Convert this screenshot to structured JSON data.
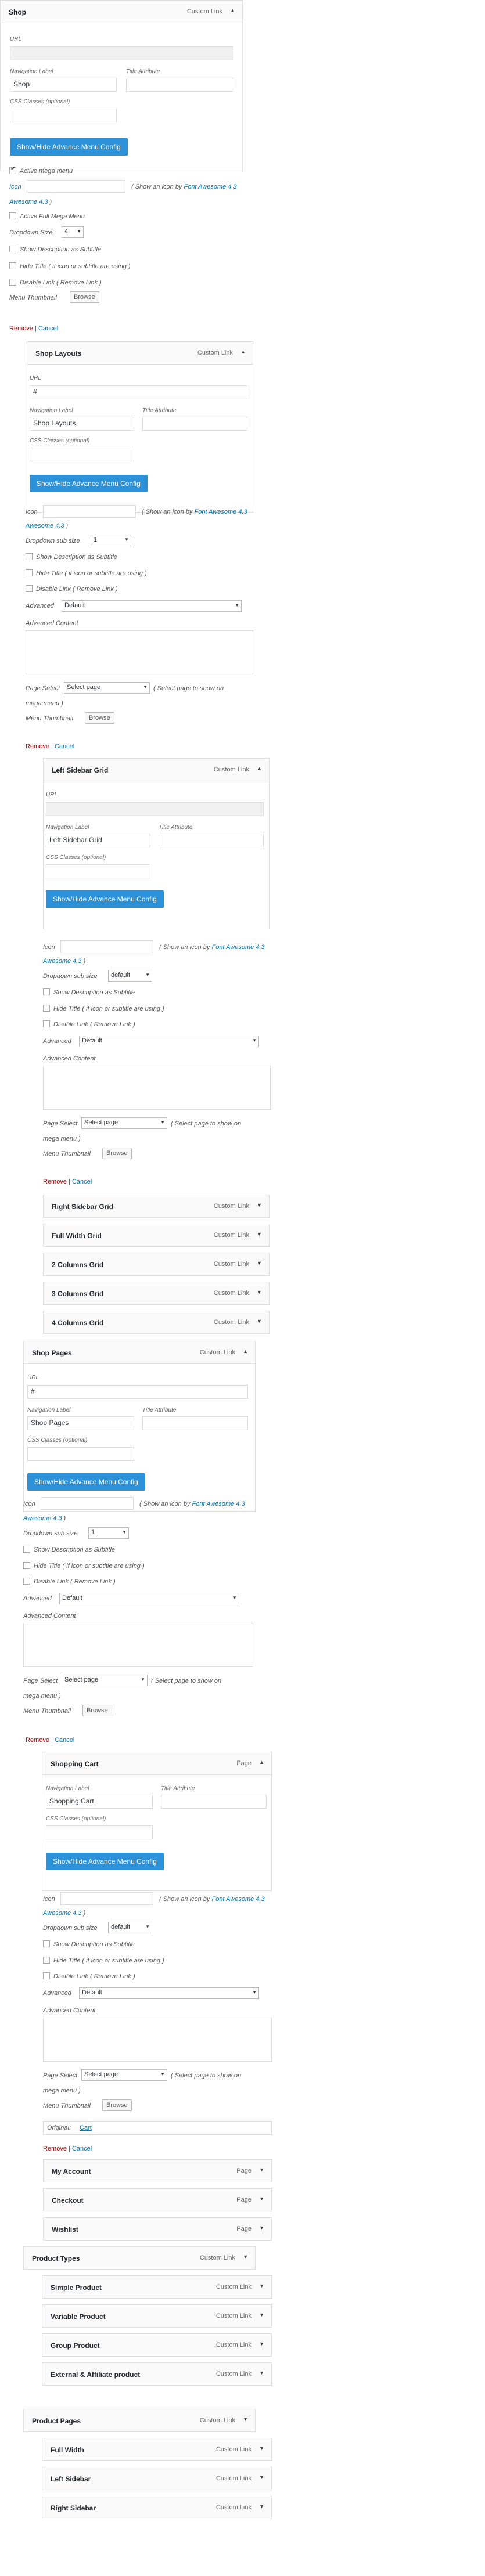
{
  "labels": {
    "url": "URL",
    "nav_label": "Navigation Label",
    "title_attr": "Title Attribute",
    "css_classes": "CSS Classes (optional)",
    "adv_config_btn": "Show/Hide Advance Menu Config",
    "active_mega": "Active mega menu",
    "icon": "Icon",
    "show_icon_pre": "( Show an icon by ",
    "font_awesome": "Font Awesome 4.3 ",
    "show_icon_post": ")",
    "active_full": "Active Full Mega Menu",
    "dropdown_size": "Dropdown Size",
    "dropdown_sub_size": "Dropdown sub size",
    "show_desc": "Show Description as Subtitle",
    "hide_title": "Hide Title ( if icon or subtitle are using )",
    "disable_link": "Disable Link ( Remove Link )",
    "advanced": "Advanced",
    "advanced_content": "Advanced Content",
    "page_select": "Page Select",
    "page_select_hint": "( Select page to show on mega menu )",
    "menu_thumbnail": "Menu Thumbnail",
    "browse": "Browse",
    "remove": "Remove",
    "sep": "|",
    "cancel": "Cancel",
    "original": "Original:",
    "custom_link": "Custom Link",
    "page": "Page"
  },
  "values": {
    "dropdown_size": "4",
    "dropdown_sub_size_1": "1",
    "dropdown_sub_size_default": "default",
    "advanced_default": "Default",
    "select_page": "Select page",
    "url_hash": "#"
  },
  "items": {
    "shop": {
      "title": "Shop",
      "label": "Shop"
    },
    "shop_layouts": {
      "title": "Shop Layouts",
      "label": "Shop Layouts"
    },
    "left_sidebar_grid": {
      "title": "Left Sidebar Grid",
      "label": "Left Sidebar Grid"
    },
    "right_sidebar_grid": {
      "title": "Right Sidebar Grid"
    },
    "full_width_grid": {
      "title": "Full Width Grid"
    },
    "two_columns_grid": {
      "title": "2 Columns Grid"
    },
    "three_columns_grid": {
      "title": "3 Columns Grid"
    },
    "four_columns_grid": {
      "title": "4 Columns Grid"
    },
    "shop_pages": {
      "title": "Shop Pages",
      "label": "Shop Pages"
    },
    "shopping_cart": {
      "title": "Shopping Cart",
      "label": "Shopping Cart",
      "original": "Cart"
    },
    "my_account": {
      "title": "My Account"
    },
    "checkout": {
      "title": "Checkout"
    },
    "wishlist": {
      "title": "Wishlist"
    },
    "product_types": {
      "title": "Product Types"
    },
    "simple_product": {
      "title": "Simple Product"
    },
    "variable_product": {
      "title": "Variable Product"
    },
    "group_product": {
      "title": "Group Product"
    },
    "external_affiliate": {
      "title": "External & Affiliate product"
    },
    "product_pages": {
      "title": "Product Pages"
    },
    "full_width": {
      "title": "Full Width"
    },
    "left_sidebar": {
      "title": "Left Sidebar"
    },
    "right_sidebar": {
      "title": "Right Sidebar"
    }
  },
  "colors": {
    "accent": "#2b91d9",
    "link": "#0073aa",
    "remove": "#aa0000"
  }
}
